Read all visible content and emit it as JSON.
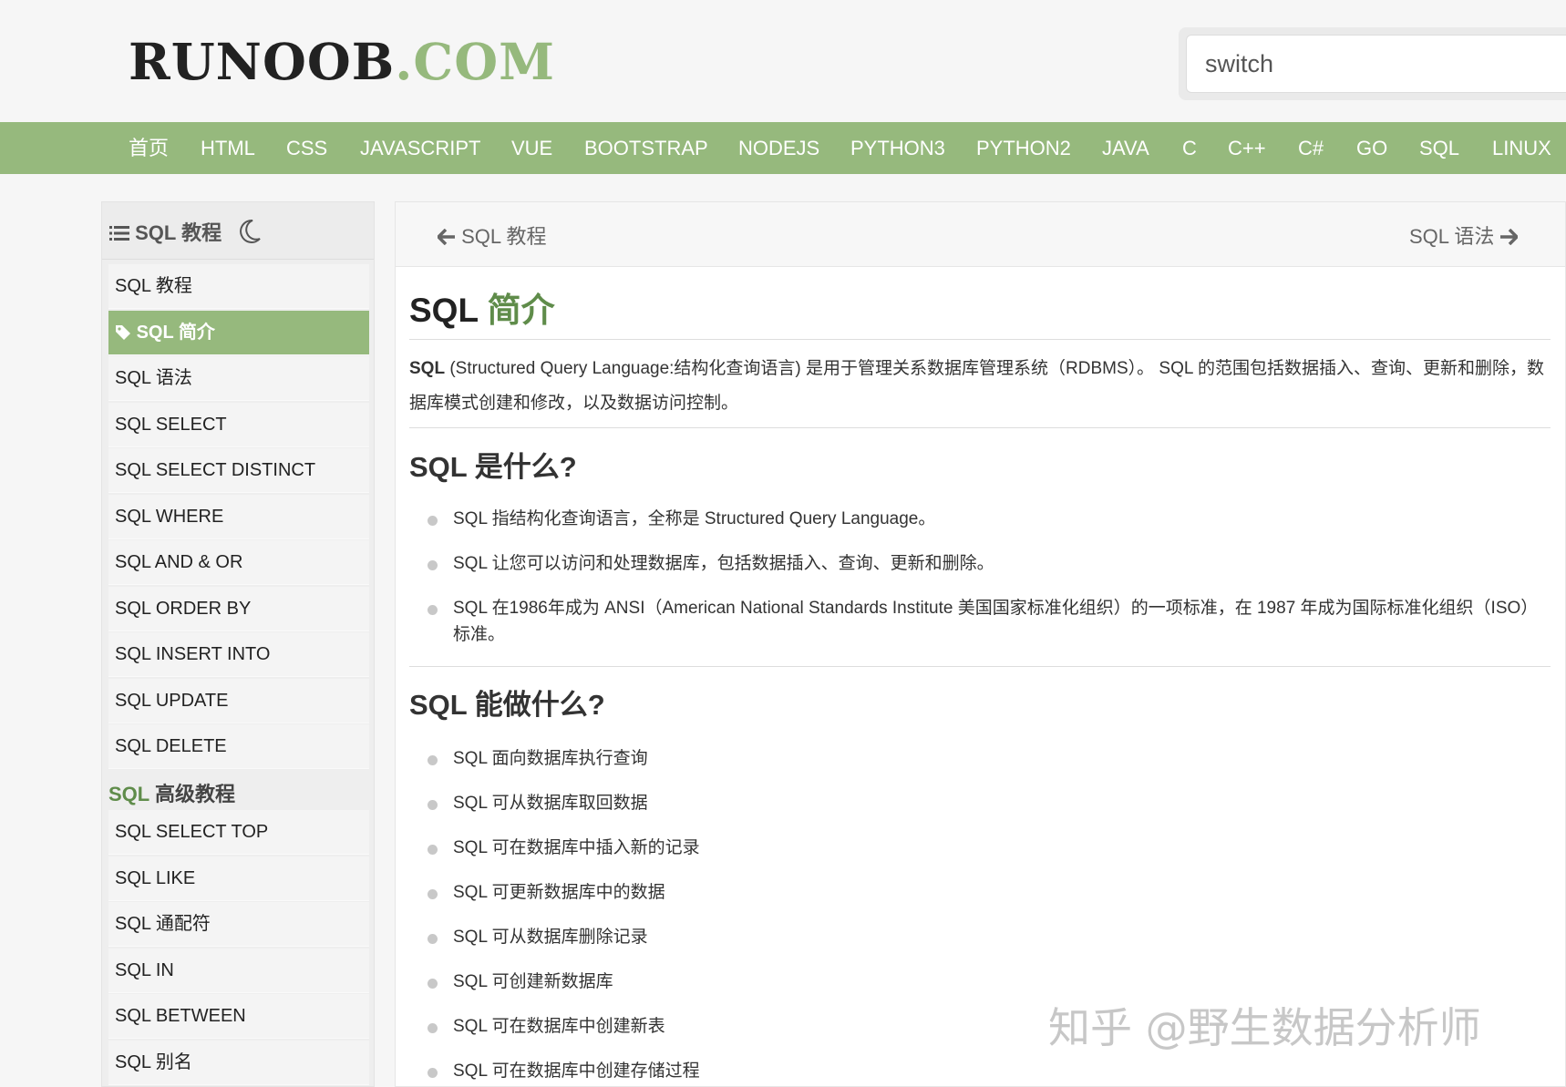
{
  "header": {
    "logo_main": "RUNOOB",
    "logo_suffix": ".COM",
    "search_value": "switch"
  },
  "nav": {
    "items": [
      "首页",
      "HTML",
      "CSS",
      "JAVASCRIPT",
      "VUE",
      "BOOTSTRAP",
      "NODEJS",
      "PYTHON3",
      "PYTHON2",
      "JAVA",
      "C",
      "C++",
      "C#",
      "GO",
      "SQL",
      "LINUX"
    ]
  },
  "sidebar": {
    "title": "SQL 教程",
    "items": [
      "SQL 教程",
      "SQL 简介",
      "SQL 语法",
      "SQL SELECT",
      "SQL SELECT DISTINCT",
      "SQL WHERE",
      "SQL AND & OR",
      "SQL ORDER BY",
      "SQL INSERT INTO",
      "SQL UPDATE",
      "SQL DELETE"
    ],
    "active_index": 1,
    "advanced_title_prefix": "SQL",
    "advanced_title_rest": " 高级教程",
    "advanced_items": [
      "SQL SELECT TOP",
      "SQL LIKE",
      "SQL 通配符",
      "SQL IN",
      "SQL BETWEEN",
      "SQL 别名"
    ]
  },
  "content": {
    "prev": "SQL 教程",
    "next": "SQL 语法",
    "title_prefix": "SQL ",
    "title_green": "简介",
    "intro_bold": "SQL",
    "intro_rest": " (Structured Query Language:结构化查询语言) 是用于管理关系数据库管理系统（RDBMS）。 SQL 的范围包括数据插入、查询、更新和删除，数据库模式创建和修改，以及数据访问控制。",
    "section1_title": "SQL 是什么?",
    "section1_items": [
      "SQL 指结构化查询语言，全称是 Structured Query Language。",
      "SQL 让您可以访问和处理数据库，包括数据插入、查询、更新和删除。",
      "SQL 在1986年成为 ANSI（American National Standards Institute 美国国家标准化组织）的一项标准，在 1987 年成为国际标准化组织（ISO）标准。"
    ],
    "section2_title": "SQL 能做什么?",
    "section2_items": [
      "SQL 面向数据库执行查询",
      "SQL 可从数据库取回数据",
      "SQL 可在数据库中插入新的记录",
      "SQL 可更新数据库中的数据",
      "SQL 可从数据库删除记录",
      "SQL 可创建新数据库",
      "SQL 可在数据库中创建新表",
      "SQL 可在数据库中创建存储过程"
    ]
  },
  "watermark": "知乎 @野生数据分析师",
  "colors": {
    "accent": "#96b97d",
    "accent_dark": "#5f8c4a"
  }
}
